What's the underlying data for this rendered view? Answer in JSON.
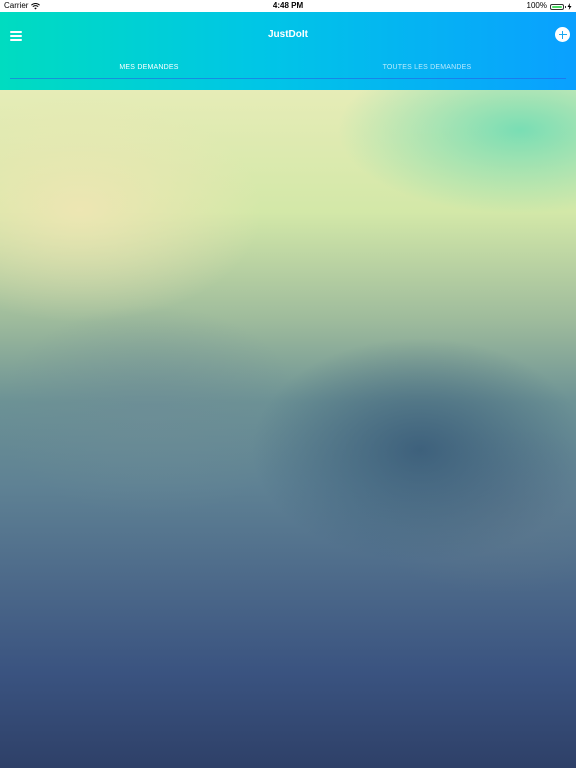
{
  "status_bar": {
    "carrier": "Carrier",
    "time": "4:48 PM",
    "battery": "100%",
    "icons": [
      "wifi-icon",
      "battery-icon",
      "charging-icon"
    ]
  },
  "header": {
    "title": "JustDoIt",
    "menu_icon": "hamburger-menu-icon",
    "add_icon": "plus-circle-icon"
  },
  "tabs": [
    {
      "label": "MES DEMANDES",
      "active": true
    },
    {
      "label": "TOUTES LES DEMANDES",
      "active": false
    }
  ],
  "colors": {
    "header_gradient_start": "#00dcc0",
    "header_gradient_end": "#0aa0ff",
    "tab_underline": "#2b5ce6",
    "background_top": "#e6ecb7",
    "background_bottom": "#2e4068"
  }
}
